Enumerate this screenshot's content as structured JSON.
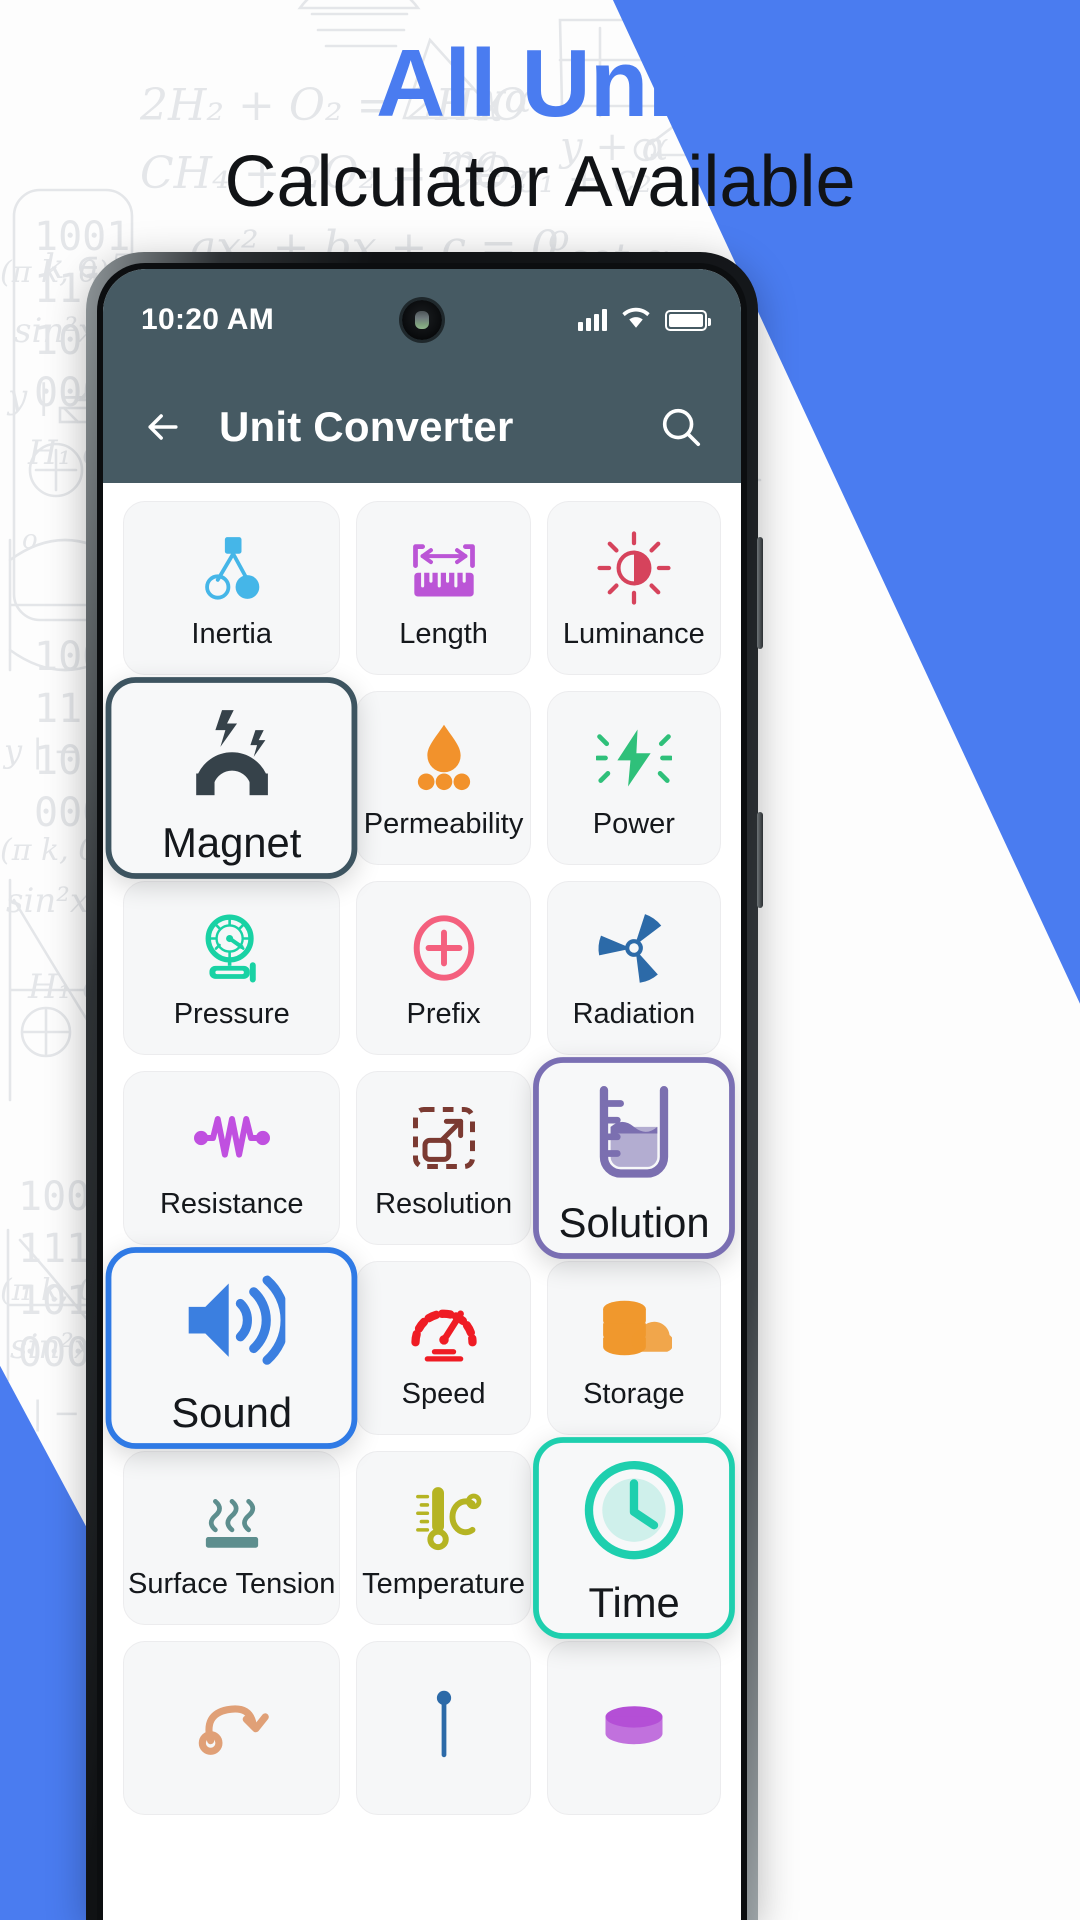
{
  "promo": {
    "line1": "All Unit",
    "line2": "Calculator Available",
    "accent_color": "#4a7cf0",
    "line2_color": "#111316"
  },
  "phone": {
    "status_bar": {
      "time": "10:20 AM",
      "icons": [
        "signal-icon",
        "wifi-icon",
        "battery-icon"
      ],
      "background_color": "#465a63"
    },
    "app_bar": {
      "back_label": "back-arrow-icon",
      "title": "Unit Converter",
      "search_label": "search-icon",
      "background_color": "#465a63"
    }
  },
  "grid": {
    "tiles": [
      {
        "label": "Inertia",
        "icon": "inertia-icon",
        "color": "#45b6e8",
        "highlight": null
      },
      {
        "label": "Length",
        "icon": "ruler-icon",
        "color": "#bb55d6",
        "highlight": null
      },
      {
        "label": "Luminance",
        "icon": "luminance-icon",
        "color": "#d6435c",
        "highlight": null
      },
      {
        "label": "Magnet",
        "icon": "magnet-icon",
        "color": "#36424a",
        "highlight": "#3d5460"
      },
      {
        "label": "Permeability",
        "icon": "permeability-icon",
        "color": "#f2922c",
        "highlight": null
      },
      {
        "label": "Power",
        "icon": "power-bolt-icon",
        "color": "#2fc07a",
        "highlight": null
      },
      {
        "label": "Pressure",
        "icon": "pressure-gauge-icon",
        "color": "#19d2a4",
        "highlight": null
      },
      {
        "label": "Prefix",
        "icon": "prefix-plus-icon",
        "color": "#f4607e",
        "highlight": null
      },
      {
        "label": "Radiation",
        "icon": "radiation-icon",
        "color": "#2c6aa8",
        "highlight": null
      },
      {
        "label": "Resistance",
        "icon": "resistor-icon",
        "color": "#c050e0",
        "highlight": null
      },
      {
        "label": "Resolution",
        "icon": "resolution-icon",
        "color": "#7b3a32",
        "highlight": null
      },
      {
        "label": "Solution",
        "icon": "beaker-icon",
        "color": "#7b6fb0",
        "highlight": "#7a6fb3"
      },
      {
        "label": "Sound",
        "icon": "speaker-icon",
        "color": "#3b7fe0",
        "highlight": "#2f7ae5"
      },
      {
        "label": "Speed",
        "icon": "speedometer-icon",
        "color": "#ef1c24",
        "highlight": null
      },
      {
        "label": "Storage",
        "icon": "storage-icon",
        "color": "#f0982d",
        "highlight": null
      },
      {
        "label": "Surface Tension",
        "icon": "surface-tension-icon",
        "color": "#5d8e8e",
        "highlight": null
      },
      {
        "label": "Temperature",
        "icon": "thermometer-icon",
        "color": "#b5b423",
        "highlight": null
      },
      {
        "label": "Time",
        "icon": "clock-icon",
        "color": "#1ecfae",
        "highlight": "#1ecfae"
      },
      {
        "label": "",
        "icon": "torque-icon",
        "color": "#e0a077",
        "highlight": null
      },
      {
        "label": "",
        "icon": "pin-icon",
        "color": "#2c6aa8",
        "highlight": null
      },
      {
        "label": "",
        "icon": "volume-icon",
        "color": "#b44fd6",
        "highlight": null
      }
    ]
  }
}
